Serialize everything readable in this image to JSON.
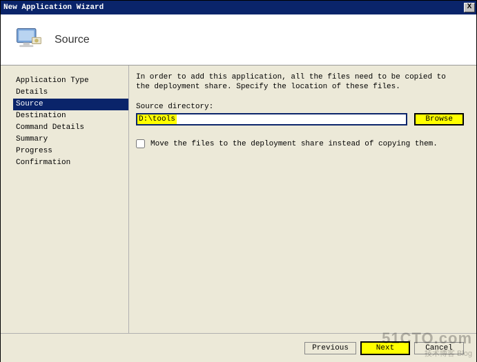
{
  "window": {
    "title": "New Application Wizard",
    "close_label": "X"
  },
  "header": {
    "page_title": "Source"
  },
  "sidebar": {
    "items": [
      {
        "label": "Application Type",
        "selected": false
      },
      {
        "label": "Details",
        "selected": false
      },
      {
        "label": "Source",
        "selected": true
      },
      {
        "label": "Destination",
        "selected": false
      },
      {
        "label": "Command Details",
        "selected": false
      },
      {
        "label": "Summary",
        "selected": false
      },
      {
        "label": "Progress",
        "selected": false
      },
      {
        "label": "Confirmation",
        "selected": false
      }
    ]
  },
  "content": {
    "instruction": "In order to add this application, all the files need to be copied to the deployment share.  Specify the location of these files.",
    "dir_label": "Source directory:",
    "dir_value": "D:\\tools",
    "browse_label": "Browse",
    "move_checkbox_label": "Move the files to the deployment share instead of copying them.",
    "move_checked": false
  },
  "footer": {
    "previous": "Previous",
    "next": "Next",
    "cancel": "Cancel"
  },
  "watermark": {
    "line1": "51CTO.com",
    "line2": "技术博客  Blog"
  }
}
